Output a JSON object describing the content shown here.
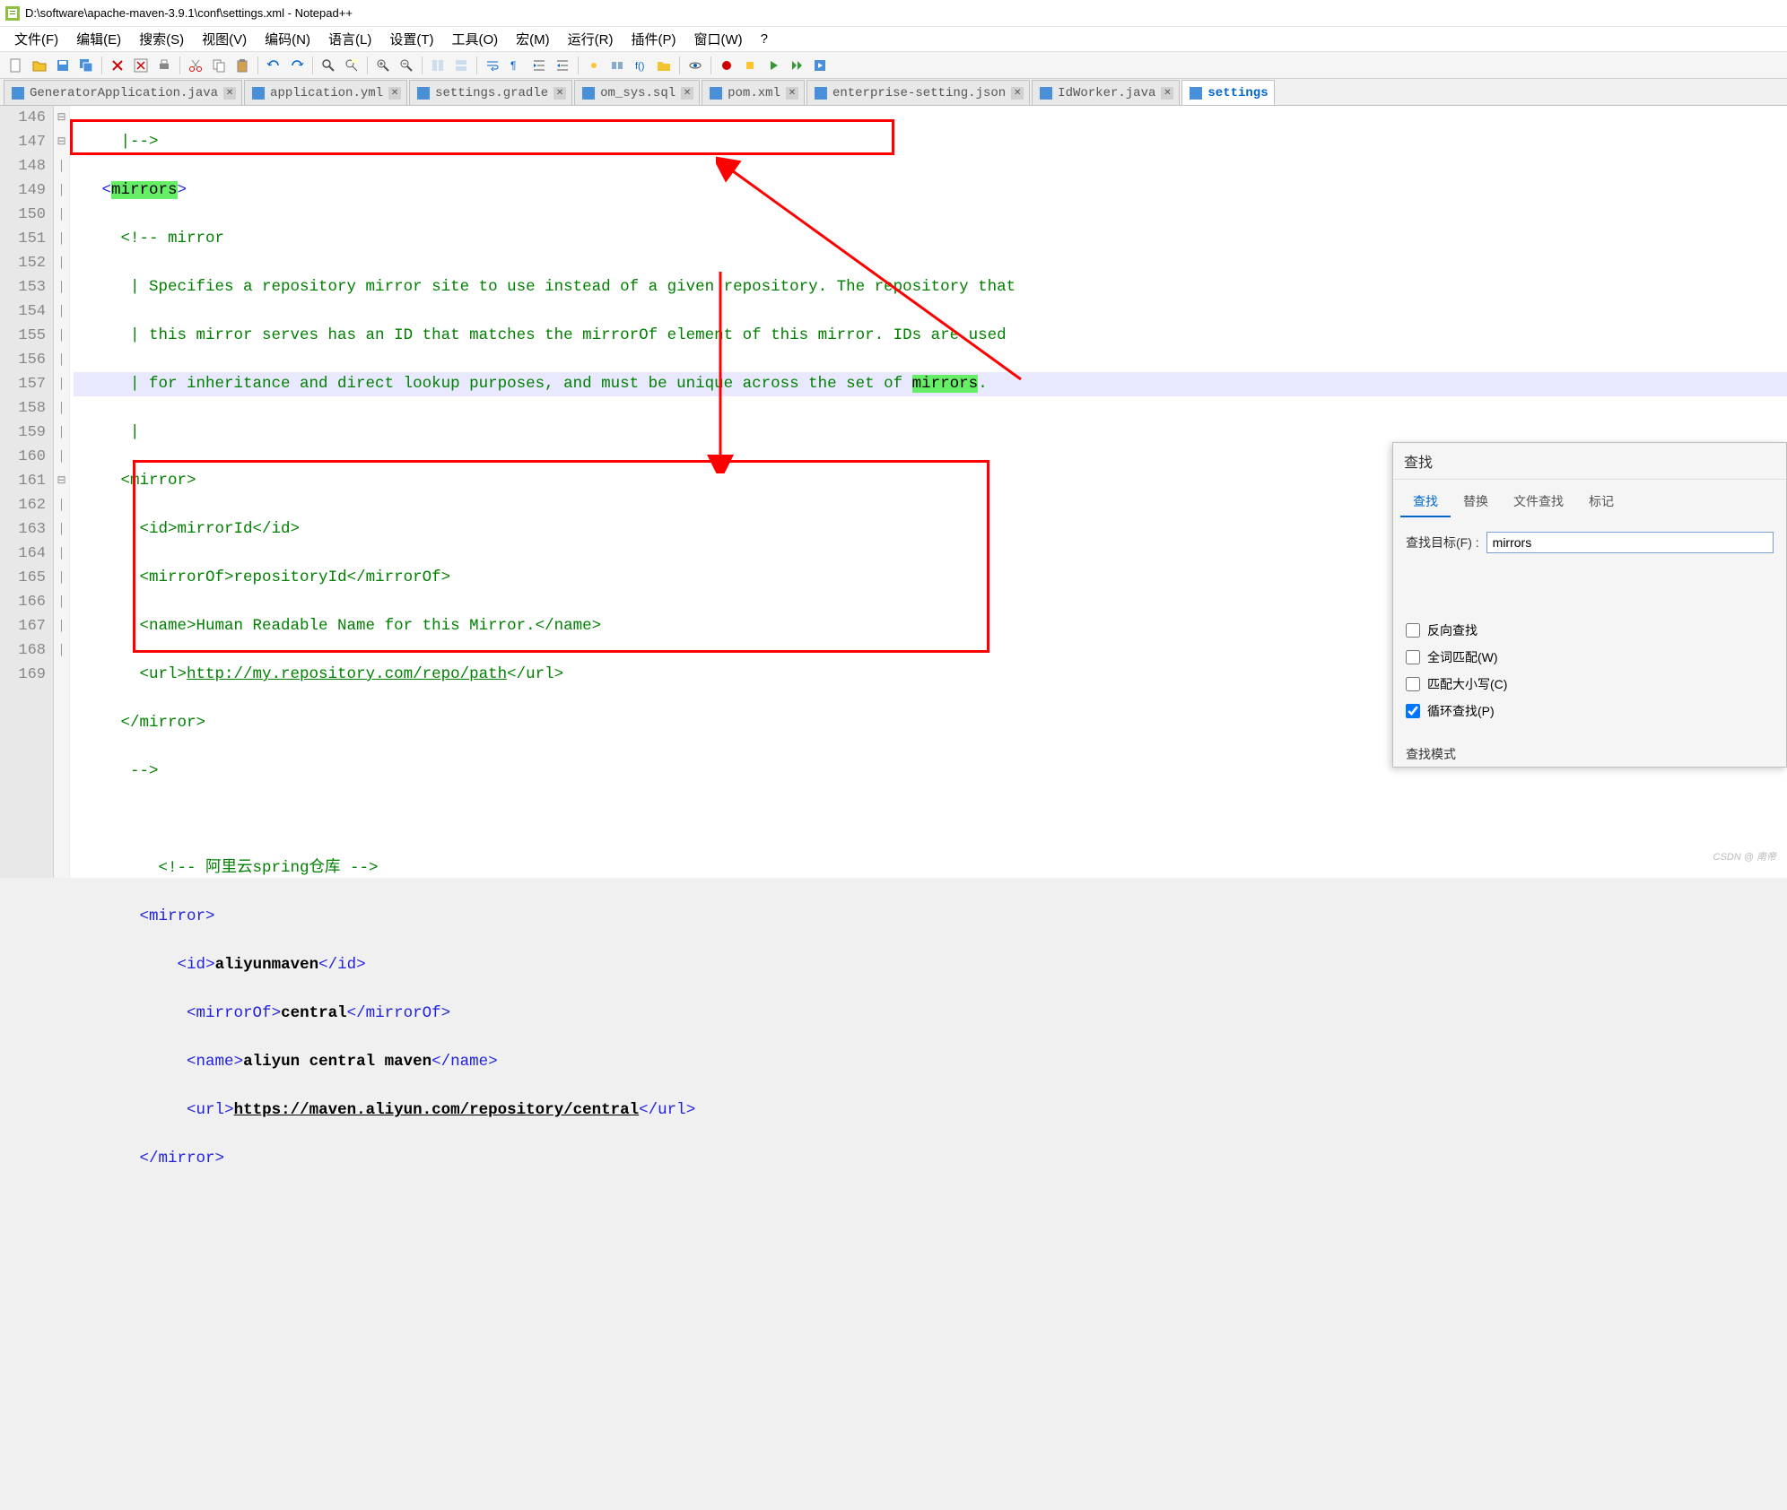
{
  "window": {
    "title": "D:\\software\\apache-maven-3.9.1\\conf\\settings.xml - Notepad++"
  },
  "menu": {
    "file": "文件(F)",
    "edit": "编辑(E)",
    "search": "搜索(S)",
    "view": "视图(V)",
    "encoding": "编码(N)",
    "language": "语言(L)",
    "settings": "设置(T)",
    "tools": "工具(O)",
    "macro": "宏(M)",
    "run": "运行(R)",
    "plugins": "插件(P)",
    "window": "窗口(W)",
    "help": "?"
  },
  "tabs": [
    {
      "label": "GeneratorApplication.java"
    },
    {
      "label": "application.yml"
    },
    {
      "label": "settings.gradle"
    },
    {
      "label": "om_sys.sql"
    },
    {
      "label": "pom.xml"
    },
    {
      "label": "enterprise-setting.json"
    },
    {
      "label": "IdWorker.java"
    },
    {
      "label": "settings"
    }
  ],
  "lines": {
    "start": 146,
    "end": 169
  },
  "code": {
    "l146": "|-->",
    "l147_open": "<",
    "l147_tag": "mirrors",
    "l147_close": ">",
    "l148": "<!-- mirror",
    "l149": " | Specifies a repository mirror site to use instead of a given repository. The repository that",
    "l150": " | this mirror serves has an ID that matches the mirrorOf element of this mirror. IDs are used",
    "l151a": " | for inheritance and direct lookup purposes, and must be unique across the set of ",
    "l151b": "mirrors",
    "l151c": ".",
    "l152": " |",
    "l153": "<mirror>",
    "l154a": "  <id>",
    "l154b": "mirrorId",
    "l154c": "</id>",
    "l155a": "  <mirrorOf>",
    "l155b": "repositoryId",
    "l155c": "</mirrorOf>",
    "l156a": "  <name>",
    "l156b": "Human Readable Name for this Mirror.",
    "l156c": "</name>",
    "l157a": "  <url>",
    "l157b": "http://my.repository.com/repo/path",
    "l157c": "</url>",
    "l158": "</mirror>",
    "l159": " -->",
    "l161": "<!-- 阿里云spring仓库 -->",
    "l162o": "<",
    "l162t": "mirror",
    "l162c": ">",
    "l163a": "<",
    "l163b": "id",
    "l163c": ">",
    "l163d": "aliyunmaven",
    "l163e": "</",
    "l163f": "id",
    "l163g": ">",
    "l164a": "<",
    "l164b": "mirrorOf",
    "l164c": ">",
    "l164d": "central",
    "l164e": "</",
    "l164f": "mirrorOf",
    "l164g": ">",
    "l165a": "<",
    "l165b": "name",
    "l165c": ">",
    "l165d": "aliyun central maven",
    "l165e": "</",
    "l165f": "name",
    "l165g": ">",
    "l166a": "<",
    "l166b": "url",
    "l166c": ">",
    "l166d": "https://maven.aliyun.com/repository/central",
    "l166e": "</",
    "l166f": "url",
    "l166g": ">",
    "l167a": "</",
    "l167b": "mirror",
    "l167c": ">"
  },
  "find": {
    "title": "查找",
    "tabs": {
      "find": "查找",
      "replace": "替换",
      "findfiles": "文件查找",
      "mark": "标记"
    },
    "target_label": "查找目标(F) :",
    "target_value": "mirrors",
    "reverse": "反向查找",
    "wholeword": "全词匹配(W)",
    "matchcase": "匹配大小写(C)",
    "wrap": "循环查找(P)",
    "mode_label": "查找模式"
  },
  "watermark": "CSDN @ 南帝"
}
